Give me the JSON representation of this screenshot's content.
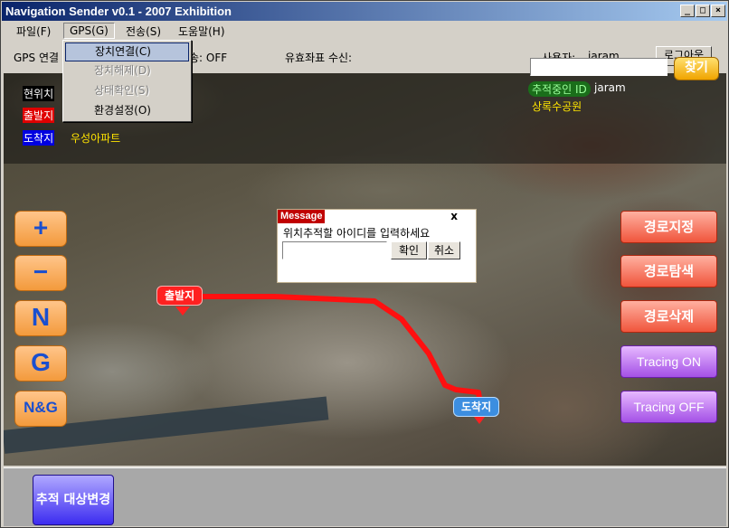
{
  "window": {
    "title": "Navigation Sender v0.1 - 2007 Exhibition"
  },
  "menubar": {
    "items": [
      "파일(F)",
      "GPS(G)",
      "전송(S)",
      "도움말(H)"
    ]
  },
  "gps_menu": {
    "items": [
      "장치연결(C)",
      "장치해제(D)",
      "상태확인(S)",
      "환경설정(O)"
    ]
  },
  "infobar": {
    "gps_label": "GPS 연결",
    "send_status": "송: OFF",
    "coord_label": "유효좌표 수신:",
    "user_label": "사용자:",
    "user_name": "jaram",
    "logout_label": "로그아웃"
  },
  "legend": {
    "current": "현위치",
    "start": "출발지",
    "destination": "도착지",
    "destination_name": "우성아파트"
  },
  "tracking": {
    "id_label": "추적중인 ID",
    "id_value": "jaram",
    "location": "상록수공원"
  },
  "search": {
    "value": "",
    "button_label": "찾기"
  },
  "zoom_buttons": [
    "+",
    "−",
    "N",
    "G",
    "N&G"
  ],
  "route_buttons": {
    "set_route": "경로지정",
    "search_route": "경로탐색",
    "delete_route": "경로삭제",
    "tracing_on": "Tracing ON",
    "tracing_off": "Tracing OFF"
  },
  "map_markers": {
    "start": "출발지",
    "end": "도착지"
  },
  "dialog": {
    "title": "Message",
    "close": "x",
    "message": "위치추적할 아이디를 입력하세요",
    "input_value": "",
    "confirm": "확인",
    "cancel": "취소"
  },
  "bottom": {
    "change_target": "추적 대상변경"
  },
  "colors": {
    "route": "#ff0000",
    "route_button": "#f0553c",
    "tracing_button": "#a450e6",
    "search_button": "#f0a400"
  }
}
